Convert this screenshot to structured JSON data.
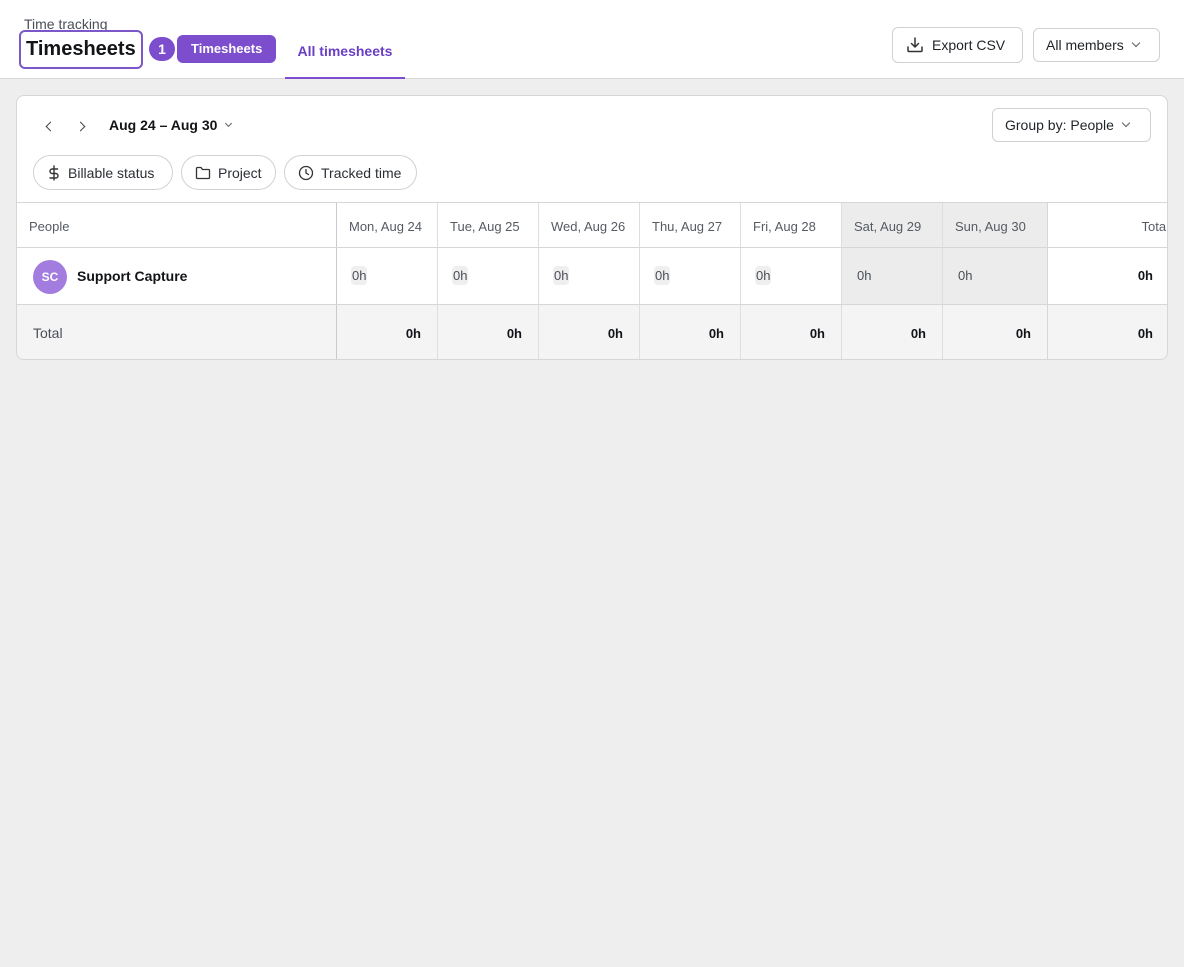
{
  "header": {
    "breadcrumb": "Time tracking",
    "title": "Timesheets",
    "badge_count": "1",
    "tab_active": "Timesheets",
    "tab_all": "All timesheets",
    "export_label": "Export CSV",
    "members_label": "All members"
  },
  "toolbar": {
    "date_range": "Aug 24 – Aug 30",
    "group_by": "Group by: People",
    "filters": [
      "Billable status",
      "Project",
      "Tracked time"
    ]
  },
  "table": {
    "people_header": "People",
    "days": [
      "Mon, Aug 24",
      "Tue, Aug 25",
      "Wed, Aug 26",
      "Thu, Aug 27",
      "Fri, Aug 28",
      "Sat, Aug 29",
      "Sun, Aug 30"
    ],
    "total_header": "Total",
    "rows": [
      {
        "initials": "SC",
        "name": "Support Capture",
        "values": [
          "0h",
          "0h",
          "0h",
          "0h",
          "0h",
          "0h",
          "0h"
        ],
        "total": "0h"
      }
    ],
    "totals": {
      "label": "Total",
      "values": [
        "0h",
        "0h",
        "0h",
        "0h",
        "0h",
        "0h",
        "0h"
      ],
      "total": "0h"
    }
  },
  "colors": {
    "accent": "#7c4dcc",
    "avatar": "#a37ce0",
    "weekend": "#ececec"
  }
}
